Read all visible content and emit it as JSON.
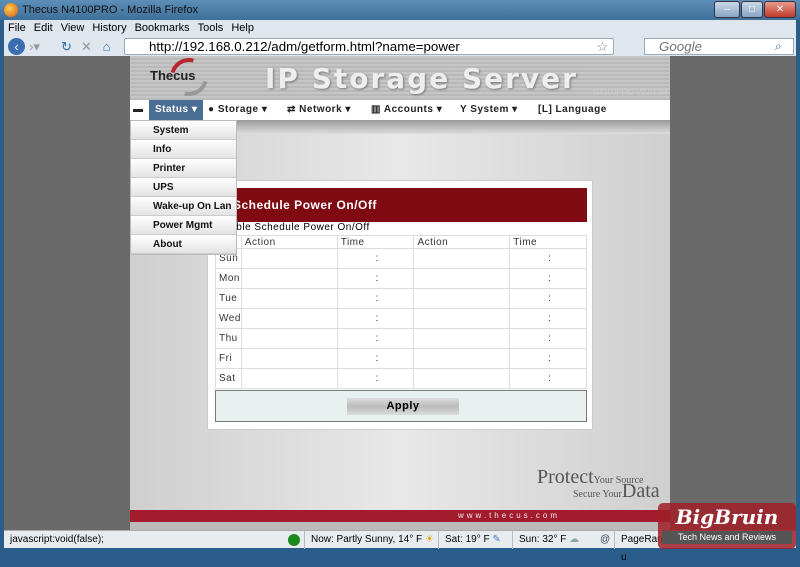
{
  "window": {
    "title": "Thecus N4100PRO - Mozilla Firefox"
  },
  "menu": [
    "File",
    "Edit",
    "View",
    "History",
    "Bookmarks",
    "Tools",
    "Help"
  ],
  "toolbar": {
    "url": "http://192.168.0.212/adm/getform.html?name=power",
    "search_placeholder": "Google"
  },
  "header": {
    "logo": "Thecus",
    "brand": "IP Storage Server",
    "version": "N4100PRO V2.01.04"
  },
  "nav": [
    "Status",
    "Storage",
    "Network",
    "Accounts",
    "System",
    "Language"
  ],
  "dropdown": [
    "System",
    "Info",
    "Printer",
    "UPS",
    "Wake-up On Lan",
    "Power Mgmt",
    "About"
  ],
  "panel": {
    "title": "Schedule Power On/Off",
    "enable_label": "Enable Schedule Power On/Off",
    "columns": [
      "Action",
      "Time",
      "Action",
      "Time"
    ],
    "days": [
      "Sun",
      "Mon",
      "Tue",
      "Wed",
      "Thu",
      "Fri",
      "Sat"
    ],
    "time_sep": ":",
    "apply": "Apply"
  },
  "footer": {
    "protect": "Protect",
    "your_source": "Your Source",
    "secure_your": "Secure Your",
    "data": "Data",
    "url": "www.thecus.com"
  },
  "statusbar": {
    "text": "javascript:void(false);",
    "now": "Now: Partly Sunny, 14° F",
    "sat": "Sat: 19° F",
    "sun": "Sun: 32° F",
    "pagerank": "PageRank: u"
  },
  "watermark": {
    "name": "BigBruin",
    "tagline": "Tech News and Reviews"
  }
}
